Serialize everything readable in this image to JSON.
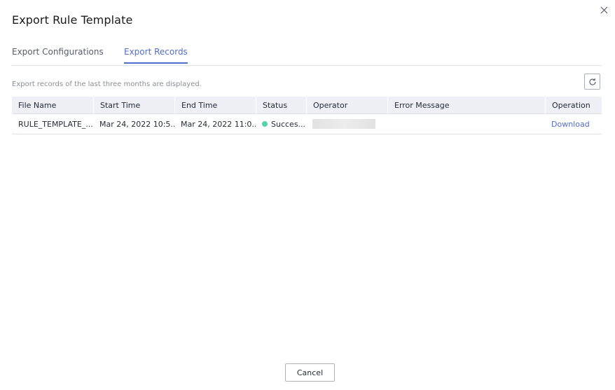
{
  "dialog": {
    "title": "Export Rule Template",
    "close_icon": "close-icon"
  },
  "tabs": [
    {
      "label": "Export Configurations",
      "active": false
    },
    {
      "label": "Export Records",
      "active": true
    }
  ],
  "hint": "Export records of the last three months are displayed.",
  "refresh_icon": "refresh-icon",
  "table": {
    "columns": [
      "File Name",
      "Start Time",
      "End Time",
      "Status",
      "Operator",
      "Error Message",
      "Operation"
    ],
    "rows": [
      {
        "file_name": "RULE_TEMPLATE_...",
        "start_time": "Mar 24, 2022 10:5...",
        "end_time": "Mar 24, 2022 11:0...",
        "status": "Succes...",
        "status_color": "#50d4ab",
        "operator": "",
        "error_message": "",
        "operation": "Download"
      }
    ]
  },
  "footer": {
    "cancel_label": "Cancel"
  },
  "colors": {
    "accent": "#526ecc",
    "success": "#50d4ab"
  }
}
